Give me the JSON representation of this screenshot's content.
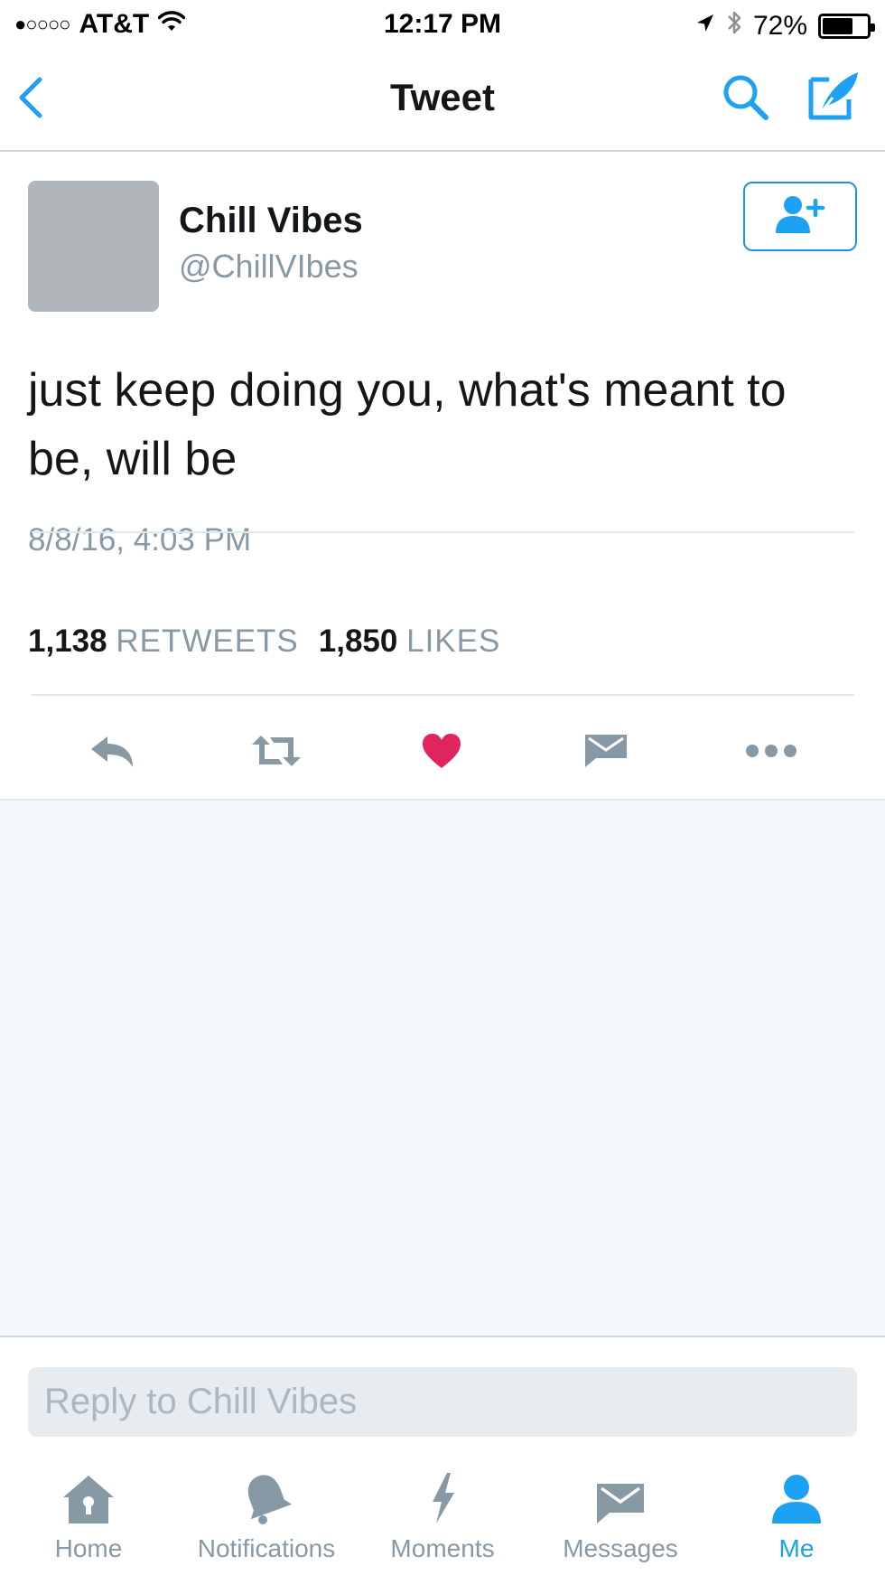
{
  "status_bar": {
    "signal": "●○○○○",
    "carrier": "AT&T",
    "time": "12:17 PM",
    "battery_percent": "72%",
    "battery_level": 0.72
  },
  "nav": {
    "title": "Tweet"
  },
  "tweet": {
    "display_name": "Chill Vibes",
    "handle": "@ChillVIbes",
    "text": "just keep doing you, what's meant to be, will be",
    "timestamp": "8/8/16, 4:03 PM",
    "retweet_count": "1,138",
    "retweet_label": "RETWEETS",
    "like_count": "1,850",
    "like_label": "LIKES"
  },
  "reply": {
    "placeholder": "Reply to Chill Vibes"
  },
  "tabs": [
    {
      "label": "Home",
      "icon": "home-icon"
    },
    {
      "label": "Notifications",
      "icon": "bell-icon"
    },
    {
      "label": "Moments",
      "icon": "lightning-icon"
    },
    {
      "label": "Messages",
      "icon": "envelope-icon"
    },
    {
      "label": "Me",
      "icon": "person-icon",
      "active": true
    }
  ],
  "colors": {
    "accent": "#1da1f2",
    "like": "#e0245e",
    "icon_gray": "#8899a6"
  }
}
